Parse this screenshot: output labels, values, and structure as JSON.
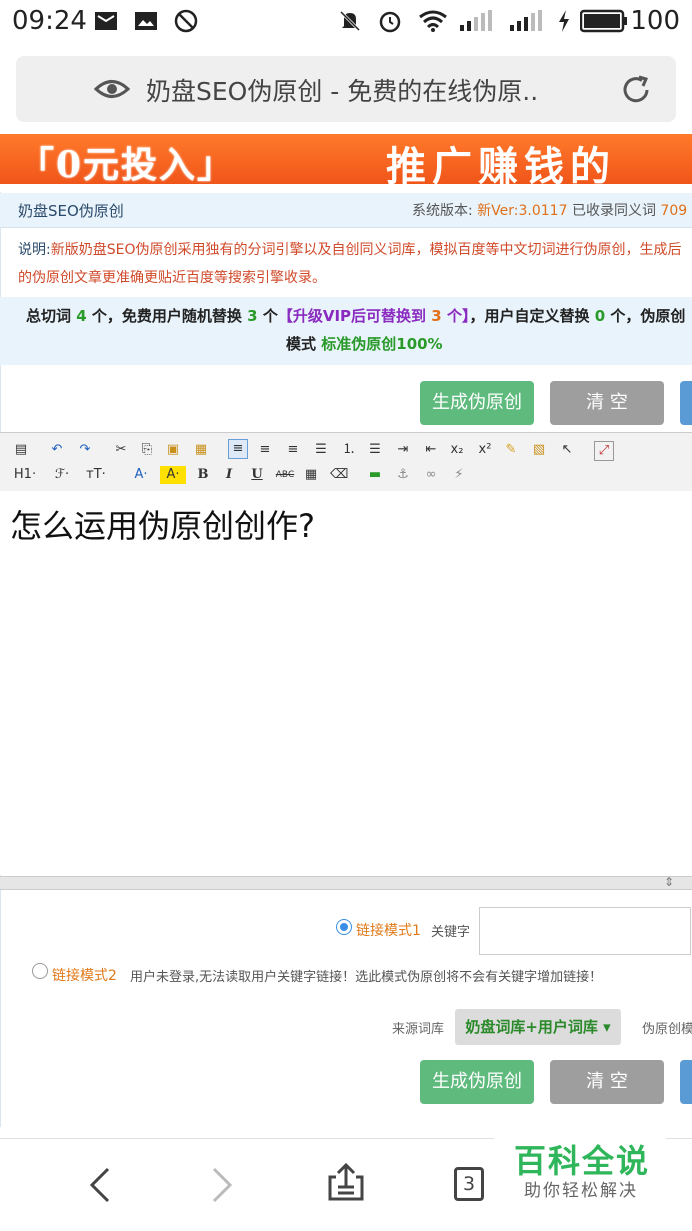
{
  "status_bar": {
    "time": "09:24",
    "battery": "100"
  },
  "browser": {
    "page_title": "奶盘SEO伪原创 - 免费的在线伪原.."
  },
  "banner": {
    "left": "「0元投入」",
    "right": "推广赚钱的"
  },
  "header": {
    "title": "奶盘SEO伪原创",
    "version_label": "系统版本:",
    "version": "新Ver:3.0117",
    "synonyms_label": "已收录同义词",
    "synonyms_count": "709"
  },
  "description": {
    "label": "说明:",
    "text": "新版奶盘SEO伪原创采用独有的分词引擎以及自创同义词库，模拟百度等中文切词进行伪原创，生成后的伪原创文章更准确更贴近百度等搜索引擎收录。"
  },
  "stats": {
    "p1": "总切词",
    "total": "4",
    "p2": "个，免费用户随机替换",
    "random": "3",
    "p3": "个",
    "vip": "【升级VIP后可替换到",
    "vip_count": "3",
    "vip_end": "个】",
    "p4": "，用户自定义替换",
    "custom": "0",
    "p5": "个，伪原创",
    "mode_label": "模式",
    "mode": "标准伪原创100%"
  },
  "buttons": {
    "generate": "生成伪原创",
    "clear": "清 空"
  },
  "toolbar": {
    "heading": "H1·",
    "font": "ℱ·",
    "size": "тT·",
    "font_color": "A·",
    "bg_color": "A·",
    "bold": "B",
    "italic": "I",
    "underline": "U",
    "strike": "ABC",
    "sub": "x₂",
    "sup": "x²"
  },
  "editor": {
    "content": "怎么运用伪原创创作?"
  },
  "link_mode": {
    "mode1": "链接模式1",
    "keyword_label": "关键字",
    "mode2": "链接模式2",
    "mode2_note": "用户未登录,无法读取用户关键字链接！选此模式伪原创将不会有关键字增加链接！"
  },
  "source": {
    "label": "来源词库",
    "selected": "奶盘词库+用户词库 ▾",
    "extra_label": "伪原创模"
  },
  "nav": {
    "tabs": "3"
  },
  "watermark": {
    "title": "百科全说",
    "subtitle": "助你轻松解决"
  },
  "colors": {
    "green_btn": "#5fba7d",
    "gray_btn": "#9e9e9e",
    "banner": "#f0551a"
  }
}
